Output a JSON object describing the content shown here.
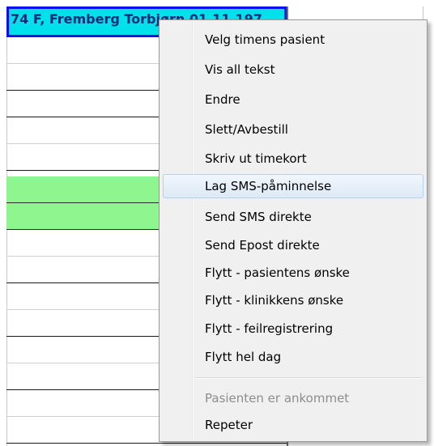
{
  "schedule": {
    "appointment_text": "74 F, Fremberg Torbjørn 01.11.197"
  },
  "context_menu": {
    "items": [
      {
        "label": "Velg timens pasient"
      },
      {
        "label": "Vis all tekst"
      },
      {
        "label": "Endre"
      },
      {
        "label": "Slett/Avbestill"
      },
      {
        "label": "Skriv ut timekort"
      },
      {
        "label": "Lag SMS-påminnelse"
      },
      {
        "label": "Send SMS direkte"
      },
      {
        "label": "Send Epost direkte"
      },
      {
        "label": "Flytt - pasientens ønske"
      },
      {
        "label": "Flytt - klinikkens ønske"
      },
      {
        "label": "Flytt - feilregistrering"
      },
      {
        "label": "Flytt hel dag"
      },
      {
        "label": "Pasienten er ankommet"
      },
      {
        "label": "Repeter"
      }
    ],
    "hovered_item": "Lag SMS-påminnelse",
    "disabled_item": "Pasienten er ankommet"
  },
  "colors": {
    "appointment_fill": "#00e1ec",
    "appointment_border": "#0e0ef3",
    "free_slot_green": "#8ef58f",
    "menu_background": "#f0f0f0",
    "menu_hover": "#dde9f6"
  }
}
